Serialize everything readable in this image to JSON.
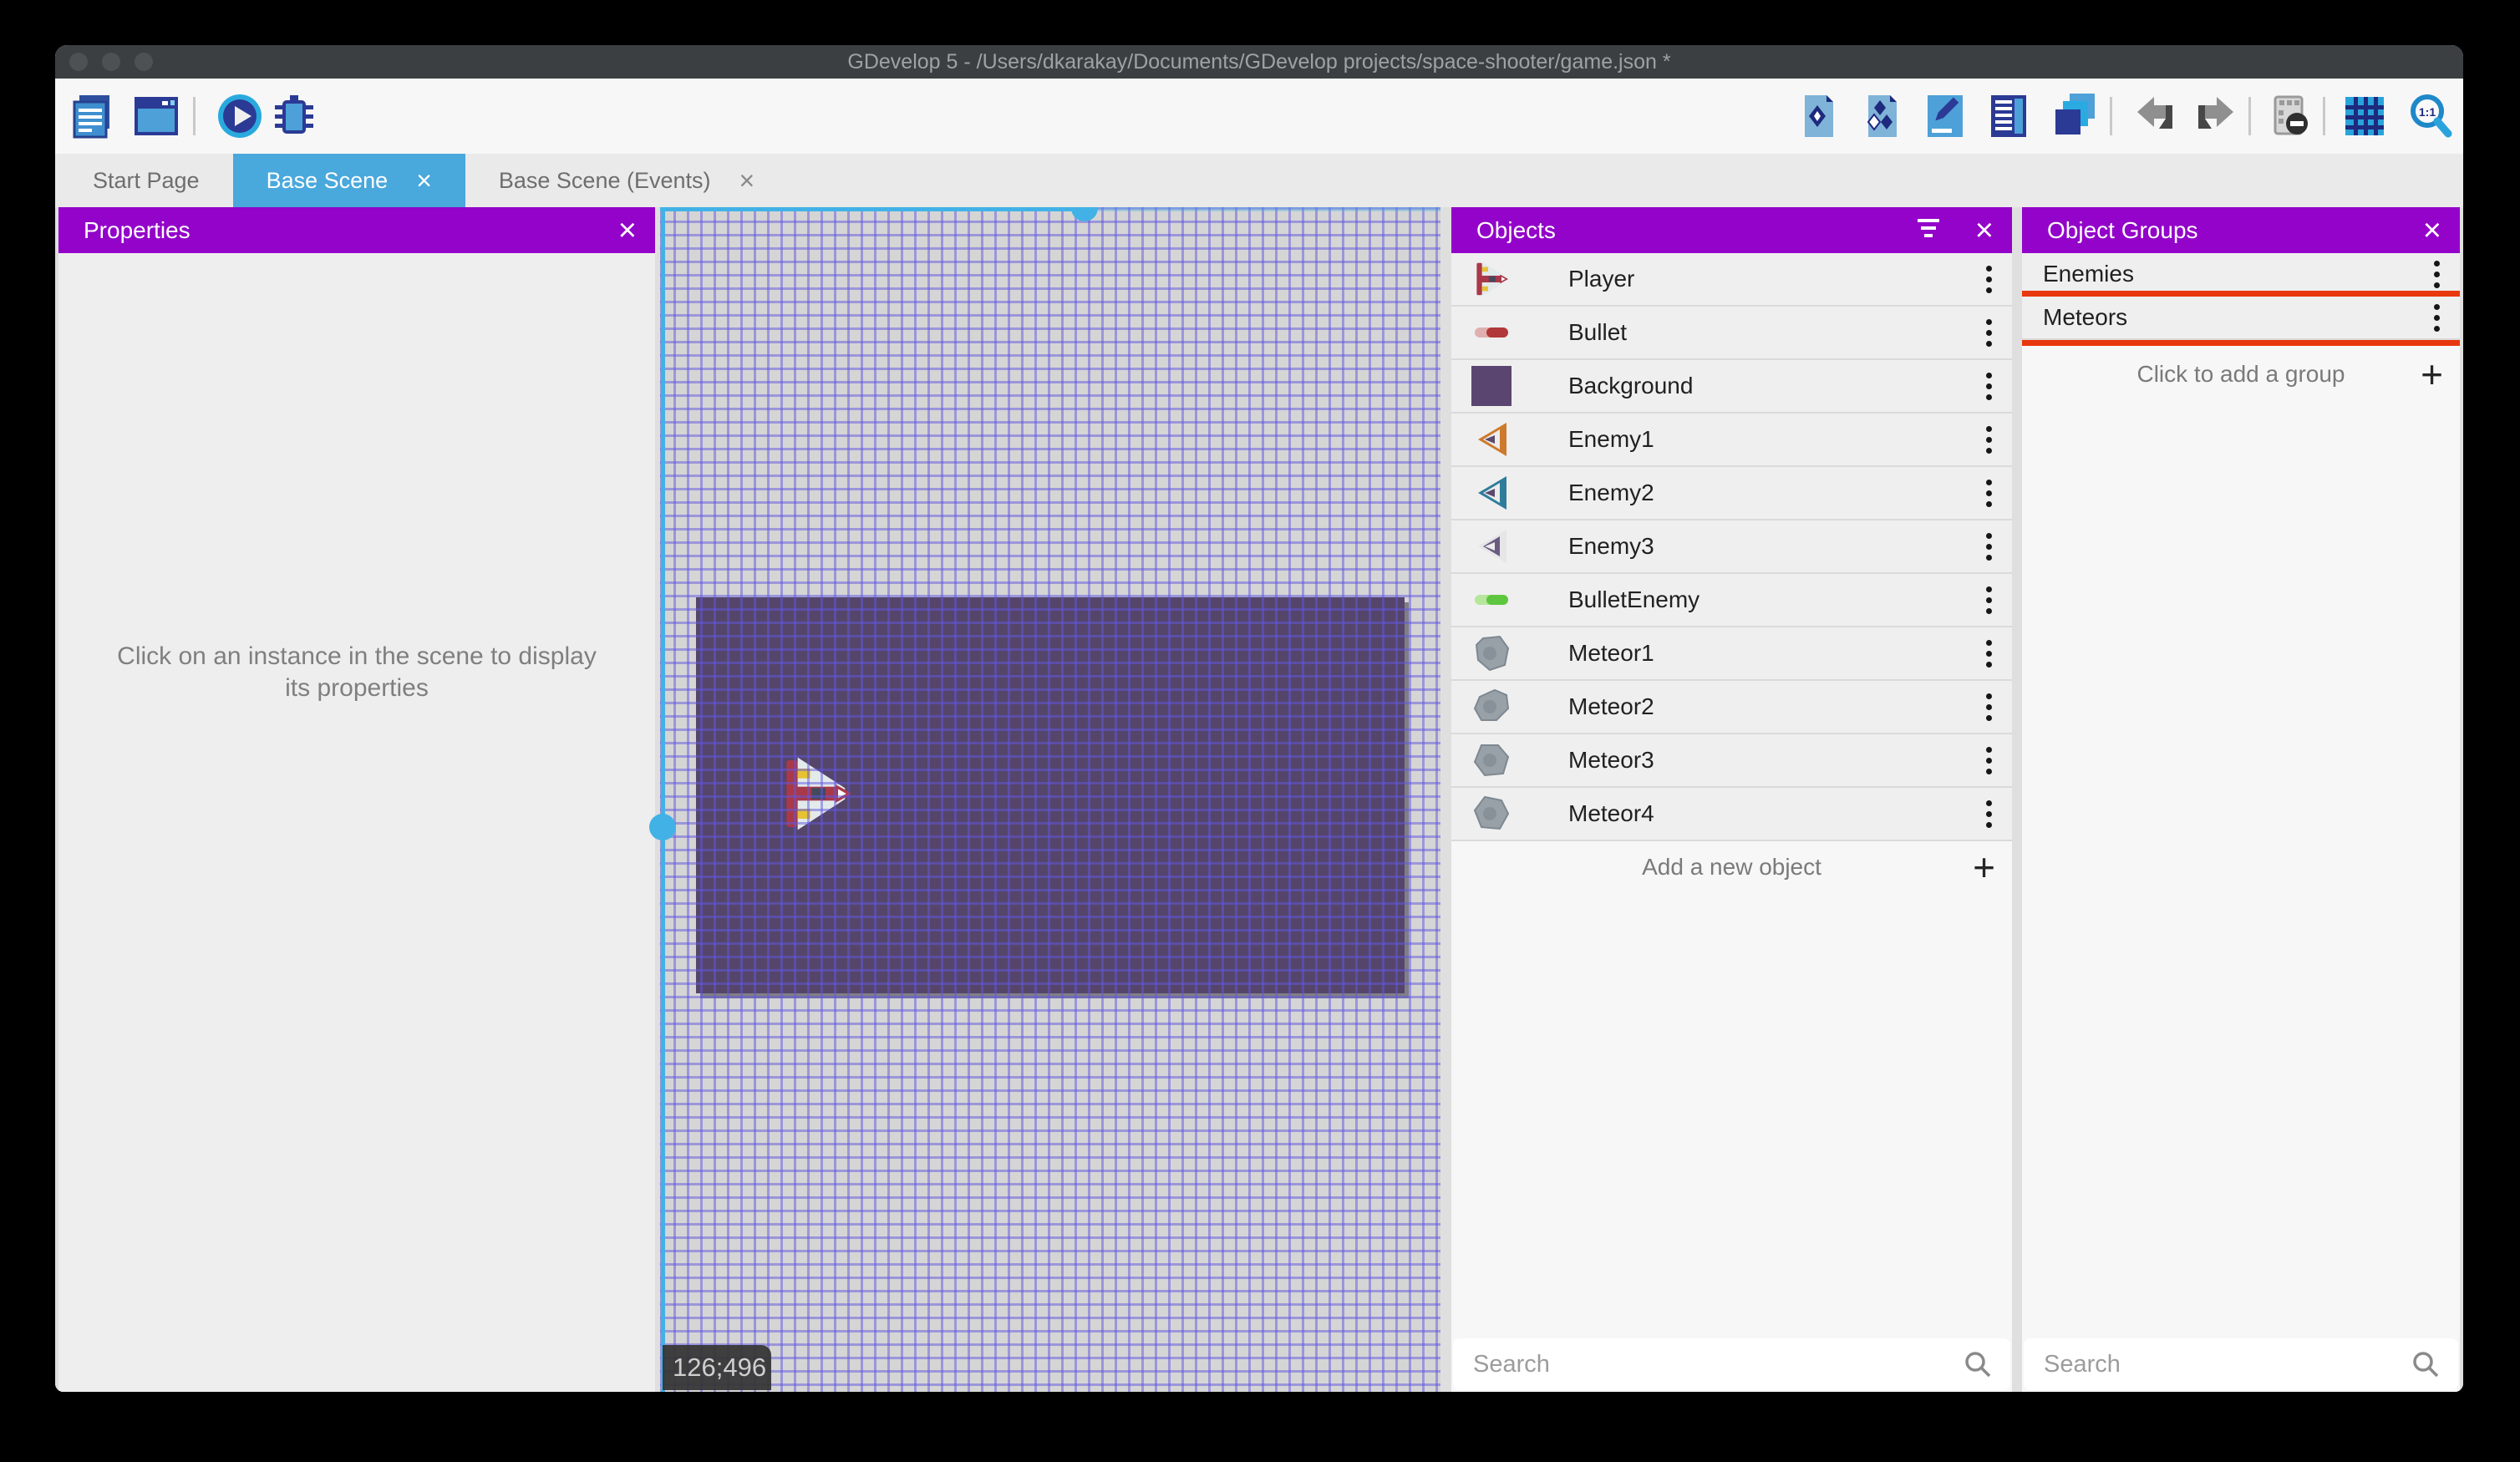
{
  "window": {
    "title": "GDevelop 5 - /Users/dkarakay/Documents/GDevelop projects/space-shooter/game.json *"
  },
  "toolbar": {
    "left_icons": [
      "project-manager-icon",
      "start-page-icon",
      "preview-play-icon",
      "debug-icon"
    ],
    "right_icons": [
      "objects-editor-icon",
      "object-groups-editor-icon",
      "properties-editor-icon",
      "instances-list-icon",
      "layers-editor-icon",
      "undo-icon",
      "redo-icon",
      "window-mask-icon",
      "grid-icon",
      "zoom-1-1-icon"
    ]
  },
  "tabs": [
    {
      "label": "Start Page",
      "active": false,
      "closable": false
    },
    {
      "label": "Base Scene",
      "active": true,
      "closable": true,
      "close_glyph": "×"
    },
    {
      "label": "Base Scene (Events)",
      "active": false,
      "closable": true,
      "close_glyph": "×"
    }
  ],
  "properties_panel": {
    "title": "Properties",
    "close_glyph": "×",
    "empty_message": "Click on an instance in the scene to display its properties"
  },
  "scene": {
    "coordinates_badge": "126;496",
    "visible_instance": "Player"
  },
  "objects_panel": {
    "title": "Objects",
    "close_glyph": "×",
    "items": [
      {
        "name": "Player",
        "icon": "player-ship"
      },
      {
        "name": "Bullet",
        "icon": "bullet-red"
      },
      {
        "name": "Background",
        "icon": "background-square"
      },
      {
        "name": "Enemy1",
        "icon": "enemy1-ship"
      },
      {
        "name": "Enemy2",
        "icon": "enemy2-ship"
      },
      {
        "name": "Enemy3",
        "icon": "enemy3-ship"
      },
      {
        "name": "BulletEnemy",
        "icon": "bullet-green"
      },
      {
        "name": "Meteor1",
        "icon": "meteor-1"
      },
      {
        "name": "Meteor2",
        "icon": "meteor-2"
      },
      {
        "name": "Meteor3",
        "icon": "meteor-3"
      },
      {
        "name": "Meteor4",
        "icon": "meteor-4"
      }
    ],
    "add_label": "Add a new object",
    "add_glyph": "+",
    "search_placeholder": "Search"
  },
  "object_groups_panel": {
    "title": "Object Groups",
    "close_glyph": "×",
    "items": [
      {
        "name": "Enemies",
        "highlighted": false
      },
      {
        "name": "Meteors",
        "highlighted": true
      }
    ],
    "add_label": "Click to add a group",
    "add_glyph": "+",
    "search_placeholder": "Search"
  },
  "colors": {
    "panel_header_purple": "#9303c9",
    "active_tab_blue": "#49a8dc",
    "selection_cyan": "#42b2e6",
    "annotation_red": "#e8380d",
    "scene_background_purple": "#55456a",
    "titlebar_gray": "#3b3f42"
  }
}
